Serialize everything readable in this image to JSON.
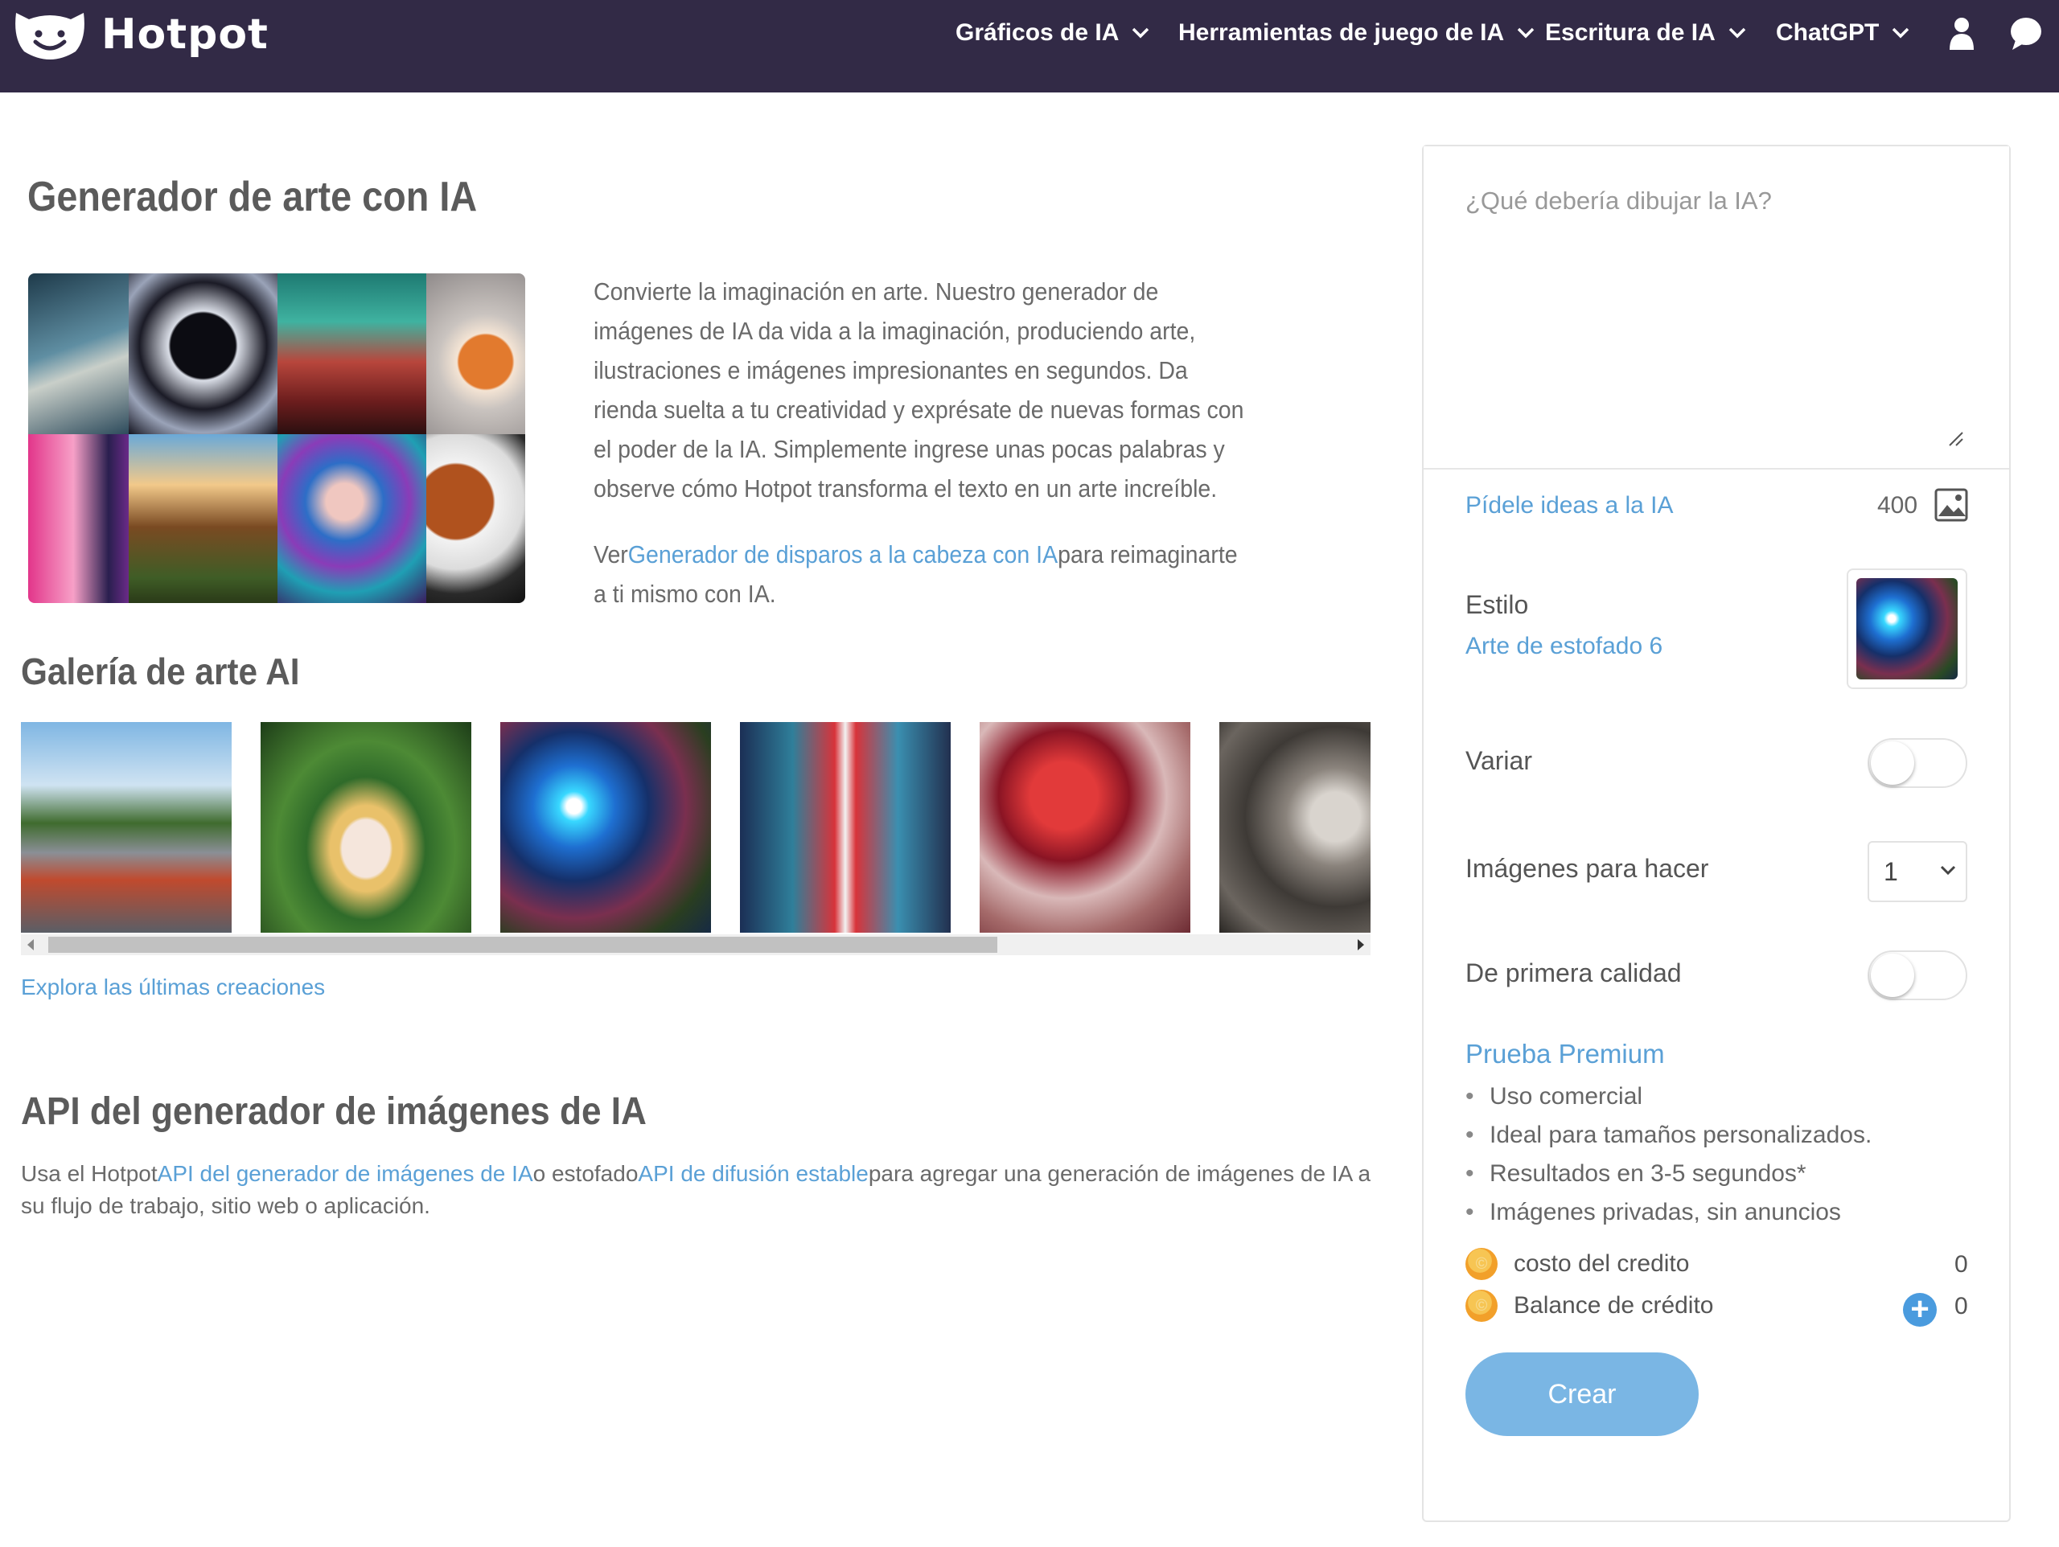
{
  "header": {
    "brand": "Hotpot",
    "nav": [
      {
        "label": "Gráficos de IA"
      },
      {
        "label": "Herramientas de juego de IA"
      },
      {
        "label": "Escritura de IA"
      },
      {
        "label": "ChatGPT"
      }
    ],
    "icons": [
      "user-icon",
      "chat-icon"
    ]
  },
  "main": {
    "title": "Generador de arte con IA",
    "intro": "Convierte la imaginación en arte. Nuestro generador de imágenes de IA da vida a la imaginación, produciendo arte, ilustraciones e imágenes impresionantes en segundos. Da rienda suelta a tu creatividad y exprésate de nuevas formas con el poder de la IA. Simplemente ingrese unas pocas palabras y observe cómo Hotpot transforma el texto en un arte increíble.",
    "see_prefix": "Ver",
    "see_link": "Generador de disparos a la cabeza con IA",
    "see_suffix": "para reimaginarte a ti mismo con IA.",
    "gallery_title": "Galería de arte AI",
    "explore_link": "Explora las últimas creaciones",
    "api_title": "API del generador de imágenes de IA",
    "api_prefix": "Usa el Hotpot",
    "api_link1": "API del generador de imágenes de IA",
    "api_middle": "o estofado",
    "api_link2": "API de difusión estable",
    "api_suffix": "para agregar una generación de imágenes de IA a su flujo de trabajo, sitio web o aplicación."
  },
  "panel": {
    "prompt_placeholder": "¿Qué debería dibujar la IA?",
    "ideas_link": "Pídele ideas a la IA",
    "char_count": "400",
    "style_label": "Estilo",
    "style_value": "Arte de estofado 6",
    "vary_label": "Variar",
    "vary_on": false,
    "images_label": "Imágenes para hacer",
    "images_value": "1",
    "premium_quality_label": "De primera calidad",
    "premium_quality_on": false,
    "premium_link": "Prueba Premium",
    "premium_features": [
      "Uso comercial",
      "Ideal para tamaños personalizados.",
      "Resultados en 3-5 segundos*",
      "Imágenes privadas, sin anuncios"
    ],
    "credit_cost_label": "costo del credito",
    "credit_cost_value": "0",
    "credit_balance_label": "Balance de crédito",
    "credit_balance_value": "0",
    "create_button": "Crear"
  },
  "colors": {
    "header_bg": "#322a46",
    "link": "#5aa0d6",
    "create_button": "#7ab6e4",
    "add_credit": "#4a9bde",
    "coin": "#f2a02a"
  }
}
